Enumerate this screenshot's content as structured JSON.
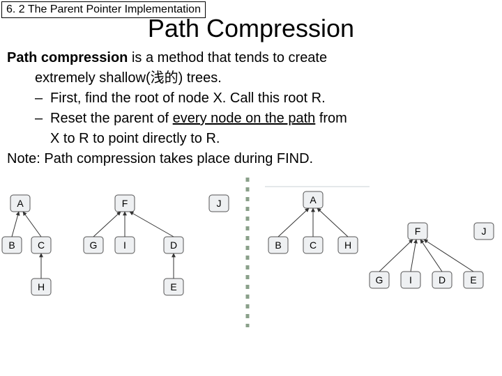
{
  "breadcrumb": "6. 2 The Parent Pointer Implementation",
  "title": "Path Compression",
  "para": {
    "lead1a": "Path compression",
    "lead1b": " is a method that tends to create",
    "lead2": "extremely shallow(浅的) trees.",
    "b1": "First, find the root of node X. Call this root R.",
    "b2a": "Reset the parent of ",
    "b2u": "every node on the path",
    "b2b": " from",
    "b2c": "X to R to point directly to R.",
    "note": "Note: Path compression takes place during FIND."
  },
  "nodes": {
    "A": "A",
    "B": "B",
    "C": "C",
    "D": "D",
    "E": "E",
    "F": "F",
    "G": "G",
    "H": "H",
    "I": "I",
    "J": "J"
  }
}
